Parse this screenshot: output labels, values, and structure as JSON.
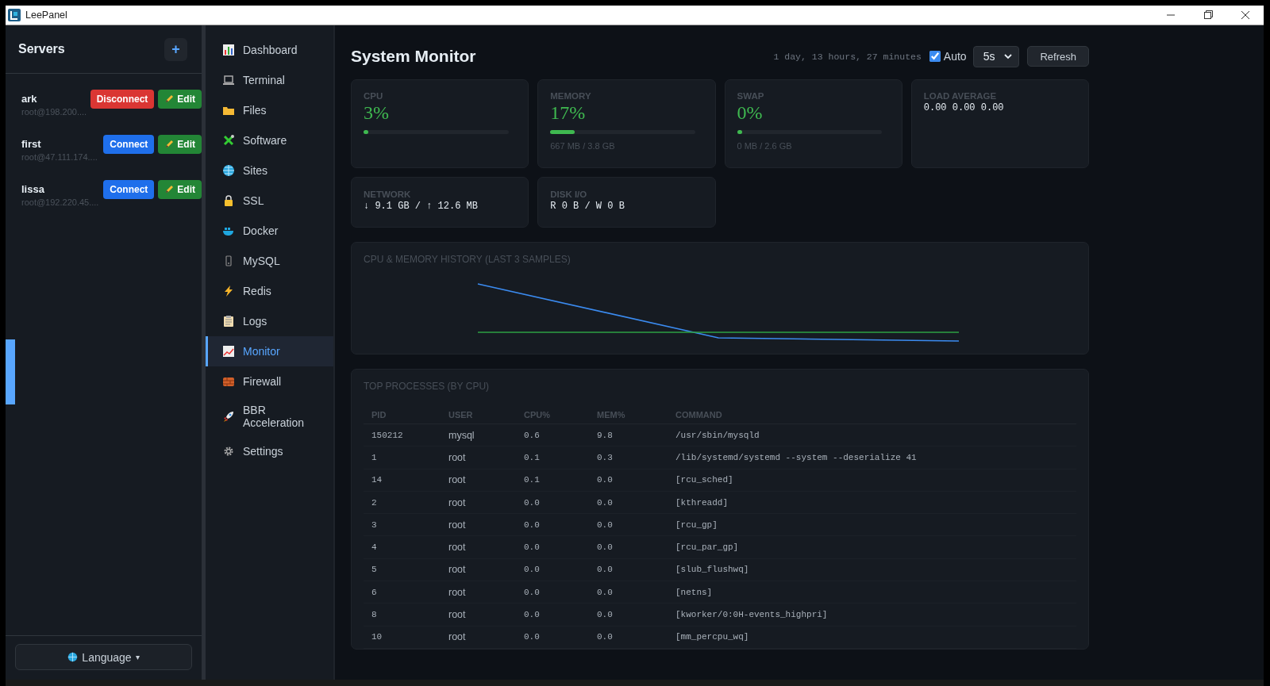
{
  "window": {
    "title": "LeePanel"
  },
  "servers": {
    "title": "Servers",
    "add_button": "+",
    "items": [
      {
        "name": "ark",
        "address": "root@198.200....",
        "connected": true,
        "action": "Disconnect",
        "edit": "Edit"
      },
      {
        "name": "first",
        "address": "root@47.111.174....",
        "connected": false,
        "action": "Connect",
        "edit": "Edit"
      },
      {
        "name": "lissa",
        "address": "root@192.220.45....",
        "connected": false,
        "action": "Connect",
        "edit": "Edit"
      }
    ],
    "language": {
      "label": "Language",
      "caret": "▾"
    }
  },
  "nav": [
    {
      "label": "Dashboard",
      "selected": false
    },
    {
      "label": "Terminal",
      "selected": false
    },
    {
      "label": "Files",
      "selected": false
    },
    {
      "label": "Software",
      "selected": false
    },
    {
      "label": "Sites",
      "selected": false
    },
    {
      "label": "SSL",
      "selected": false
    },
    {
      "label": "Docker",
      "selected": false
    },
    {
      "label": "MySQL",
      "selected": false
    },
    {
      "label": "Redis",
      "selected": false
    },
    {
      "label": "Logs",
      "selected": false
    },
    {
      "label": "Monitor",
      "selected": true
    },
    {
      "label": "Firewall",
      "selected": false
    },
    {
      "label": "BBR Acceleration",
      "selected": false
    },
    {
      "label": "Settings",
      "selected": false
    }
  ],
  "header": {
    "title": "System Monitor",
    "uptime": "1 day, 13 hours, 27 minutes",
    "auto": {
      "label": "Auto",
      "checked": true
    },
    "interval": "5s",
    "refresh": "Refresh"
  },
  "stats": [
    {
      "kind": "meter",
      "label": "CPU",
      "value": "3%",
      "level": 0.03
    },
    {
      "kind": "meter",
      "label": "MEMORY",
      "value": "17%",
      "level": 0.17,
      "detail": "667 MB / 3.8 GB"
    },
    {
      "kind": "meter",
      "label": "SWAP",
      "value": "0%",
      "level": 0,
      "detail": "0 MB / 2.6 GB"
    },
    {
      "kind": "text",
      "label": "LOAD AVERAGE",
      "value": "0.00 0.00 0.00"
    },
    {
      "kind": "text",
      "label": "NETWORK",
      "value": "↓ 9.1 GB / ↑ 12.6 MB"
    },
    {
      "kind": "text",
      "label": "DISK I/O",
      "value": "R 0 B / W 0 B"
    }
  ],
  "history": {
    "title": "CPU & MEMORY HISTORY (LAST 3 SAMPLES)"
  },
  "processes": {
    "title": "TOP PROCESSES (BY CPU)",
    "columns": [
      "PID",
      "USER",
      "CPU%",
      "MEM%",
      "COMMAND"
    ],
    "rows": [
      [
        "150212",
        "mysql",
        "0.6",
        "9.8",
        "/usr/sbin/mysqld"
      ],
      [
        "1",
        "root",
        "0.1",
        "0.3",
        "/lib/systemd/systemd --system --deserialize 41"
      ],
      [
        "14",
        "root",
        "0.1",
        "0.0",
        "[rcu_sched]"
      ],
      [
        "2",
        "root",
        "0.0",
        "0.0",
        "[kthreadd]"
      ],
      [
        "3",
        "root",
        "0.0",
        "0.0",
        "[rcu_gp]"
      ],
      [
        "4",
        "root",
        "0.0",
        "0.0",
        "[rcu_par_gp]"
      ],
      [
        "5",
        "root",
        "0.0",
        "0.0",
        "[slub_flushwq]"
      ],
      [
        "6",
        "root",
        "0.0",
        "0.0",
        "[netns]"
      ],
      [
        "8",
        "root",
        "0.0",
        "0.0",
        "[kworker/0:0H-events_highpri]"
      ],
      [
        "10",
        "root",
        "0.0",
        "0.0",
        "[mm_percpu_wq]"
      ]
    ]
  }
}
